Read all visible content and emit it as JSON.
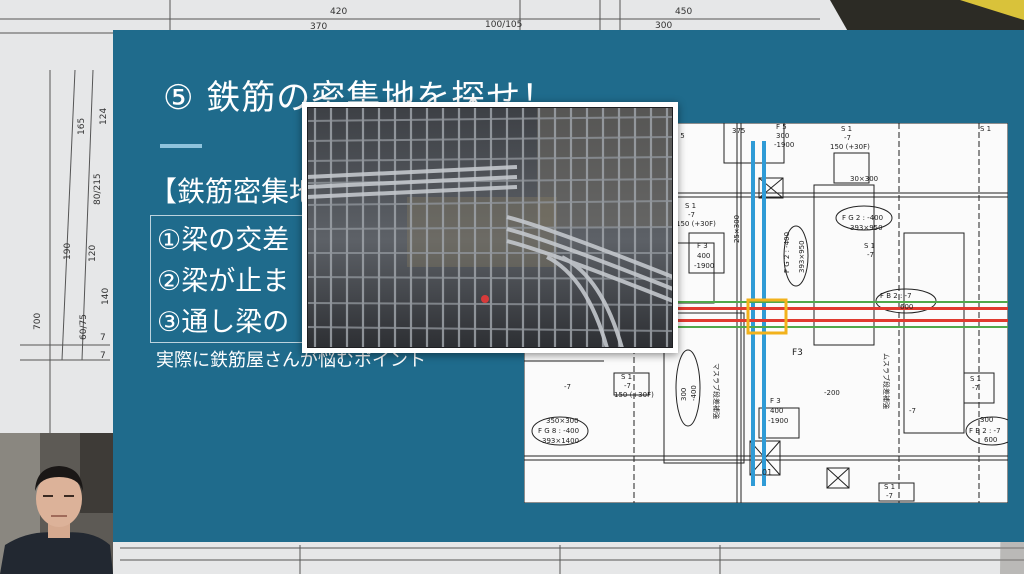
{
  "background": {
    "dimensions_top": [
      "420",
      "450",
      "370",
      "100/105",
      "300"
    ],
    "dimensions_left": [
      "124",
      "165",
      "80/215",
      "190",
      "120",
      "140",
      "60/75",
      "700",
      "7",
      "7"
    ]
  },
  "slide": {
    "title": "⑤ 鉄筋の密集地を探せ！",
    "subheading": "【鉄筋密集地",
    "points": [
      "①梁の交差",
      "②梁が止ま",
      "③通し梁の"
    ],
    "caption": "実際に鉄筋屋さんが悩むポイント",
    "colors": {
      "background": "#1f6b8c",
      "accent": "#8fc3dc",
      "text": "#ffffff"
    }
  },
  "plan": {
    "labels": [
      "F 5",
      "300",
      "-1900",
      "375",
      "S 1",
      "-7",
      "150 (+30F)",
      "30×300",
      "F G 2 : -400",
      "393×950",
      "S 1",
      "-7",
      "150 (+30F)",
      "F 3",
      "400",
      "-1900",
      "25×300",
      "F G 2 : -400",
      "393×950",
      "S 1",
      "-7",
      "F B 2 : -7",
      "600",
      "F3",
      "300",
      "-400",
      "S 1",
      "-7",
      "150 (+30F)",
      "F 3",
      "400",
      "-1900",
      "-200",
      "-7",
      "S 1",
      "-7",
      "300",
      "F B 2 : -7",
      "600",
      "350×300",
      "F G 8 : -400",
      "393×1400",
      "-7",
      "01",
      "S 1",
      "-7",
      "マスラブ段差補強",
      "ムスラブ段差補強",
      "F 5",
      "S 1"
    ],
    "colors": {
      "column_blue": "#2f9bd6",
      "beam_red": "#e03a2f",
      "beam_green": "#4fa84a",
      "highlight": "#f2b21c"
    }
  },
  "photo": {
    "subject": "rebar-cage-photo",
    "colors": {
      "steel": "#5c6066",
      "shadow": "#2a2c30"
    }
  },
  "webcam": {
    "subject": "presenter-webcam"
  }
}
